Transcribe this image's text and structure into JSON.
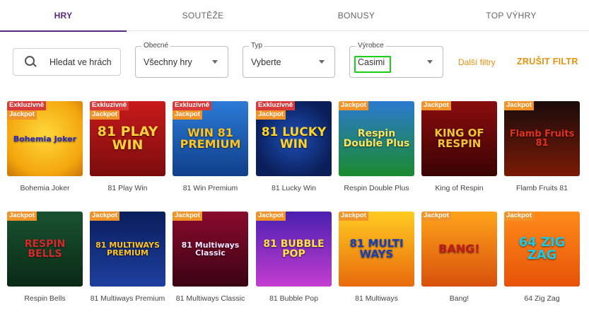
{
  "tabs": [
    "HRY",
    "SOUTĚŽE",
    "BONUSY",
    "TOP VÝHRY"
  ],
  "search": {
    "placeholder": "Hledat ve hrách"
  },
  "filters": {
    "general": {
      "label": "Obecné",
      "value": "Všechny hry"
    },
    "type": {
      "label": "Typ",
      "value": "Vyberte"
    },
    "maker": {
      "label": "Výrobce",
      "value": "Casimi"
    }
  },
  "more_filters": "Další filtry",
  "clear_filter": "ZRUŠIT FILTR",
  "badges": {
    "exclusive": "Exkluzivně",
    "jackpot": "Jackpot"
  },
  "accent_color": "#5b2a86",
  "link_color": "#e8910a",
  "games": [
    {
      "title": "Bohemia Joker",
      "exclusive": true,
      "jackpot": true,
      "art": "Bohemia Joker"
    },
    {
      "title": "81 Play Win",
      "exclusive": true,
      "jackpot": true,
      "art": "81 PLAY WIN"
    },
    {
      "title": "81 Win Premium",
      "exclusive": true,
      "jackpot": true,
      "art": "WIN 81 PREMIUM"
    },
    {
      "title": "81 Lucky Win",
      "exclusive": true,
      "jackpot": true,
      "art": "81 LUCKY WIN"
    },
    {
      "title": "Respin Double Plus",
      "exclusive": false,
      "jackpot": true,
      "art": "Respin Double Plus"
    },
    {
      "title": "King of Respin",
      "exclusive": false,
      "jackpot": true,
      "art": "KING OF RESPIN"
    },
    {
      "title": "Flamb Fruits 81",
      "exclusive": false,
      "jackpot": true,
      "art": "Flamb Fruits 81"
    },
    {
      "title": "Respin Bells",
      "exclusive": false,
      "jackpot": true,
      "art": "RESPIN BELLS"
    },
    {
      "title": "81 Multiways Premium",
      "exclusive": false,
      "jackpot": true,
      "art": "81 MULTIWAYS PREMIUM"
    },
    {
      "title": "81 Multiways Classic",
      "exclusive": false,
      "jackpot": true,
      "art": "81 Multiways Classic"
    },
    {
      "title": "81 Bubble Pop",
      "exclusive": false,
      "jackpot": true,
      "art": "81 BUBBLE POP"
    },
    {
      "title": "81 Multiways",
      "exclusive": false,
      "jackpot": true,
      "art": "81 MULTI WAYS"
    },
    {
      "title": "Bang!",
      "exclusive": false,
      "jackpot": true,
      "art": "BANG!"
    },
    {
      "title": "64 Zig Zag",
      "exclusive": false,
      "jackpot": true,
      "art": "64 ZIG ZAG"
    }
  ]
}
